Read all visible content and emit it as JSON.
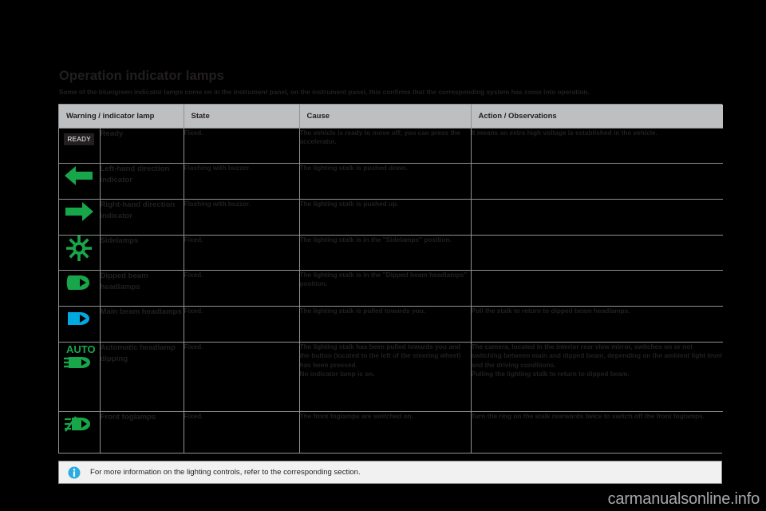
{
  "page": {
    "title": "Operation indicator lamps",
    "subtitle": "Some of the blue/green indicator lamps come on in the instrument panel, on the instrument panel, this confirms that the corresponding system has come into operation.",
    "watermark": "carmanualsonline.info"
  },
  "table": {
    "headers": [
      "Warning / indicator lamp",
      "State",
      "Cause",
      "Action / Observations"
    ],
    "rows": [
      {
        "icon": "ready-badge-icon",
        "icon_label": "READY",
        "name": "Ready",
        "state": "Fixed.",
        "cause": "The vehicle is ready to move off; you can press the accelerator.",
        "action": "It means an extra high voltage is established in the vehicle."
      },
      {
        "icon": "left-arrow-icon",
        "icon_label": "",
        "name": "Left-hand direction indicator",
        "state": "Flashing with buzzer.",
        "cause": "The lighting stalk is pushed down.",
        "action": ""
      },
      {
        "icon": "right-arrow-icon",
        "icon_label": "",
        "name": "Right-hand direction indicator",
        "state": "Flashing with buzzer.",
        "cause": "The lighting stalk is pushed up.",
        "action": ""
      },
      {
        "icon": "sidelamps-icon",
        "icon_label": "",
        "name": "Sidelamps",
        "state": "Fixed.",
        "cause": "The lighting stalk is in the \"Sidelamps\" position.",
        "action": ""
      },
      {
        "icon": "dipped-beam-icon",
        "icon_label": "",
        "name": "Dipped beam headlamps",
        "state": "Fixed.",
        "cause": "The lighting stalk is in the \"Dipped beam headlamps\" position.",
        "action": ""
      },
      {
        "icon": "main-beam-icon",
        "icon_label": "",
        "name": "Main beam headlamps",
        "state": "Fixed.",
        "cause": "The lighting stalk is pulled towards you.",
        "action": "Pull the stalk to return to dipped beam headlamps."
      },
      {
        "icon": "auto-headlamp-dipping-icon",
        "icon_label": "AUTO",
        "name": "Automatic headlamp dipping",
        "state": "Fixed.",
        "cause": "The lighting stalk has been pulled towards you and the button (located to the left of the steering wheel) has been pressed.\nNo indicator lamp is on.",
        "action": "The camera, located in the interior rear view mirror, switches on or not switching between main and dipped beam, depending on the ambient light level and the driving conditions.\nPulling the lighting stalk to return to dipped beam."
      },
      {
        "icon": "front-foglamps-icon",
        "icon_label": "",
        "name": "Front foglamps",
        "state": "Fixed.",
        "cause": "The front foglamps are switched on.",
        "action": "Turn the ring on the stalk rearwards twice to switch off the front foglamps."
      }
    ]
  },
  "note": {
    "icon": "info-icon",
    "text": "For more information on the lighting controls, refer to the corresponding section."
  },
  "colors": {
    "green": "#17a64a",
    "blue": "#00a9e0",
    "info_blue": "#29abe2",
    "header_bg": "#bdbfc1",
    "name_bg": "#dcdddf",
    "text": "#231f20"
  }
}
